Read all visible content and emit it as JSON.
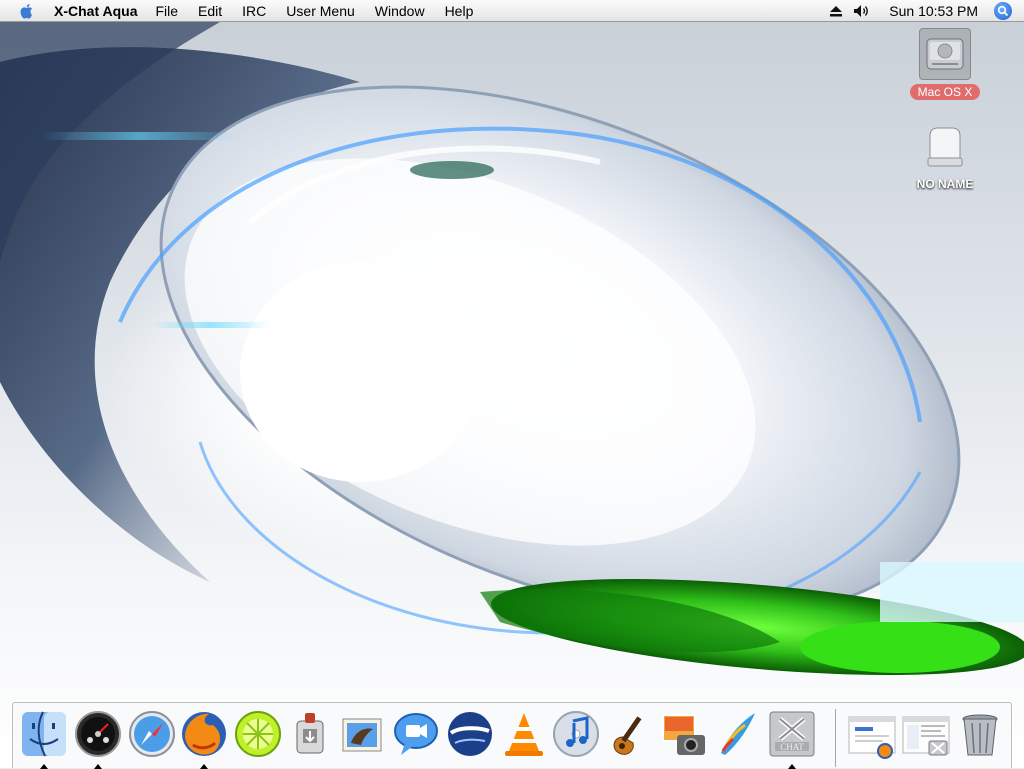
{
  "menubar": {
    "app_name": "X-Chat Aqua",
    "menus": [
      "File",
      "Edit",
      "IRC",
      "User Menu",
      "Window",
      "Help"
    ],
    "clock": "Sun 10:53 PM",
    "status_icons": [
      "eject-icon",
      "volume-icon",
      "spotlight-icon"
    ]
  },
  "desktop": {
    "icons": [
      {
        "label": "Mac OS X",
        "icon": "hard-drive-icon",
        "selected": true
      },
      {
        "label": "NO NAME",
        "icon": "removable-drive-icon",
        "selected": false
      }
    ]
  },
  "dock": {
    "apps": [
      {
        "name": "Finder",
        "icon": "finder-icon",
        "running": true
      },
      {
        "name": "Dashboard",
        "icon": "dashboard-icon",
        "running": true
      },
      {
        "name": "Safari",
        "icon": "safari-icon",
        "running": false
      },
      {
        "name": "Firefox",
        "icon": "firefox-icon",
        "running": true
      },
      {
        "name": "LimeWire",
        "icon": "limewire-icon",
        "running": false
      },
      {
        "name": "Automator",
        "icon": "automator-icon",
        "running": false
      },
      {
        "name": "Mail",
        "icon": "mail-icon",
        "running": false
      },
      {
        "name": "iChat",
        "icon": "ichat-icon",
        "running": false
      },
      {
        "name": "Google Earth",
        "icon": "google-earth-icon",
        "running": false
      },
      {
        "name": "VLC",
        "icon": "vlc-icon",
        "running": false
      },
      {
        "name": "iTunes",
        "icon": "itunes-icon",
        "running": false
      },
      {
        "name": "GarageBand",
        "icon": "garageband-icon",
        "running": false
      },
      {
        "name": "iPhoto",
        "icon": "iphoto-icon",
        "running": false
      },
      {
        "name": "Painter",
        "icon": "painter-icon",
        "running": false
      },
      {
        "name": "X-Chat Aqua",
        "icon": "xchat-icon",
        "running": true
      },
      {
        "name": "Minimized Firefox window",
        "icon": "minimized-window-icon",
        "running": false
      },
      {
        "name": "Minimized X-Chat window",
        "icon": "minimized-window-icon",
        "running": false
      },
      {
        "name": "Trash",
        "icon": "trash-icon",
        "running": false
      }
    ]
  },
  "colors": {
    "accent_green": "#2fbf1a",
    "accent_blue": "#4aa0ff",
    "selection_label": "#e06d6d"
  }
}
